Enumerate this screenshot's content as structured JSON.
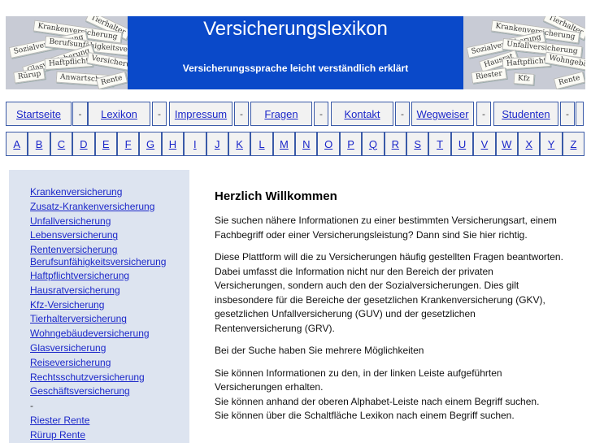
{
  "header": {
    "title": "Versicherungslexikon",
    "subtitle": "Versicherungssprache leicht verständlich erklärt",
    "image_words": [
      "Tierhalter",
      "Krankenversicherung",
      "Unfallversicherung",
      "Sozialversicherung",
      "Berufsunfähigkeitsversicherung",
      "Glasversicherung",
      "Hausrat",
      "Haftpflicht",
      "Versicherung",
      "Wohngebäude",
      "Kfz",
      "Rürup",
      "Riester",
      "Rente",
      "Anwartschaft"
    ]
  },
  "nav": {
    "items": [
      "Startseite",
      "Lexikon",
      "Impressum",
      "Fragen",
      "Kontakt",
      "Wegweiser",
      "Studenten"
    ],
    "separator": "-"
  },
  "alphabet": [
    "A",
    "B",
    "C",
    "D",
    "E",
    "F",
    "G",
    "H",
    "I",
    "J",
    "K",
    "L",
    "M",
    "N",
    "O",
    "P",
    "Q",
    "R",
    "S",
    "T",
    "U",
    "V",
    "W",
    "X",
    "Y",
    "Z"
  ],
  "sidebar": {
    "items": [
      "Krankenversicherung",
      "Zusatz-Krankenversicherung",
      "Unfallversicherung",
      "Lebensversicherung",
      "Rentenversicherung",
      "Berufsunfähigkeitsversicherung",
      "Haftpflichtversicherung",
      "Hausratversicherung",
      "Kfz-Versicherung",
      "Tierhalterversicherung",
      "Wohngebäudeversicherung",
      "Glasversicherung",
      "Reiseversicherung",
      "Rechtsschutzversicherung",
      "Geschäftsversicherung",
      "-",
      "Riester Rente",
      "Rürup Rente"
    ]
  },
  "main": {
    "heading": "Herzlich Willkommen",
    "paragraphs": [
      "Sie suchen nähere Informationen zu einer bestimmten Versicherungsart, einem Fachbegriff oder einer Versicherungsleistung? Dann sind Sie hier richtig.",
      "Diese Plattform will die zu Versicherungen häufig gestellten Fragen beantworten. Dabei umfasst die Information nicht nur den Bereich der privaten Versicherungen, sondern auch den der Sozialversicherungen. Dies gilt insbesondere für die Bereiche der gesetzlichen Krankenversicherung (GKV), gesetzlichen Unfallversicherung (GUV) und der gesetzlichen Rentenversicherung (GRV).",
      "Bei der Suche haben Sie mehrere Möglichkeiten",
      "Sie können Informationen zu den, in der linken Leiste aufgeführten Versicherungen erhalten.",
      "Sie können anhand der oberen Alphabet-Leiste nach einem Begriff suchen.",
      "Sie können über die Schaltfläche Lexikon nach einem Begriff suchen."
    ]
  },
  "colors": {
    "header_blue": "#0a49c9",
    "link_blue": "#1b27c9",
    "sidebar_bg": "#dde4f0",
    "border": "#3a5aa8"
  }
}
